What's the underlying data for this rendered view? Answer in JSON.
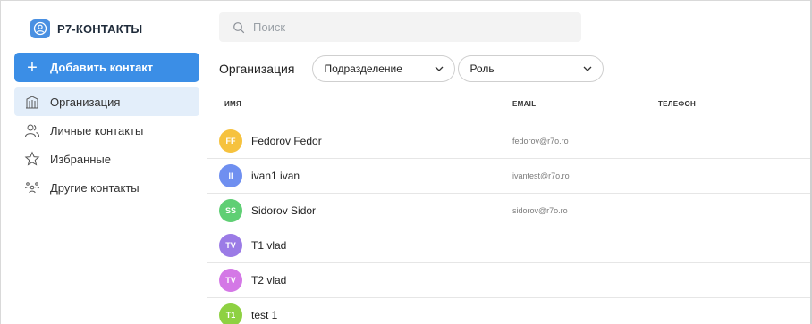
{
  "app": {
    "title": "Р7-КОНТАКТЫ",
    "logo_icon": "contacts-app-icon",
    "logo_color": "#4a90e2"
  },
  "sidebar": {
    "add_button_label": "Добавить контакт",
    "items": [
      {
        "label": "Организация",
        "icon": "building-icon",
        "active": true
      },
      {
        "label": "Личные контакты",
        "icon": "people-icon",
        "active": false
      },
      {
        "label": "Избранные",
        "icon": "star-icon",
        "active": false
      },
      {
        "label": "Другие контакты",
        "icon": "group-icon",
        "active": false
      }
    ]
  },
  "search": {
    "placeholder": "Поиск"
  },
  "filters": {
    "title": "Организация",
    "department": "Подразделение",
    "role": "Роль"
  },
  "table": {
    "headers": {
      "name": "ИМЯ",
      "email": "EMAIL",
      "phone": "ТЕЛЕФОН"
    },
    "rows": [
      {
        "initials": "FF",
        "name": "Fedorov Fedor",
        "email": "fedorov@r7o.ro",
        "color": "#f6c23e"
      },
      {
        "initials": "II",
        "name": "ivan1 ivan",
        "email": "ivantest@r7o.ro",
        "color": "#6f8ff0"
      },
      {
        "initials": "SS",
        "name": "Sidorov Sidor",
        "email": "sidorov@r7o.ro",
        "color": "#5fcf74"
      },
      {
        "initials": "TV",
        "name": "T1 vlad",
        "email": "",
        "color": "#9b7be6"
      },
      {
        "initials": "TV",
        "name": "T2 vlad",
        "email": "",
        "color": "#d478e6"
      },
      {
        "initials": "T1",
        "name": "test 1",
        "email": "",
        "color": "#8ed142"
      }
    ]
  },
  "colors": {
    "accent": "#3b8ee6",
    "active_nav_bg": "#e3eefa"
  }
}
